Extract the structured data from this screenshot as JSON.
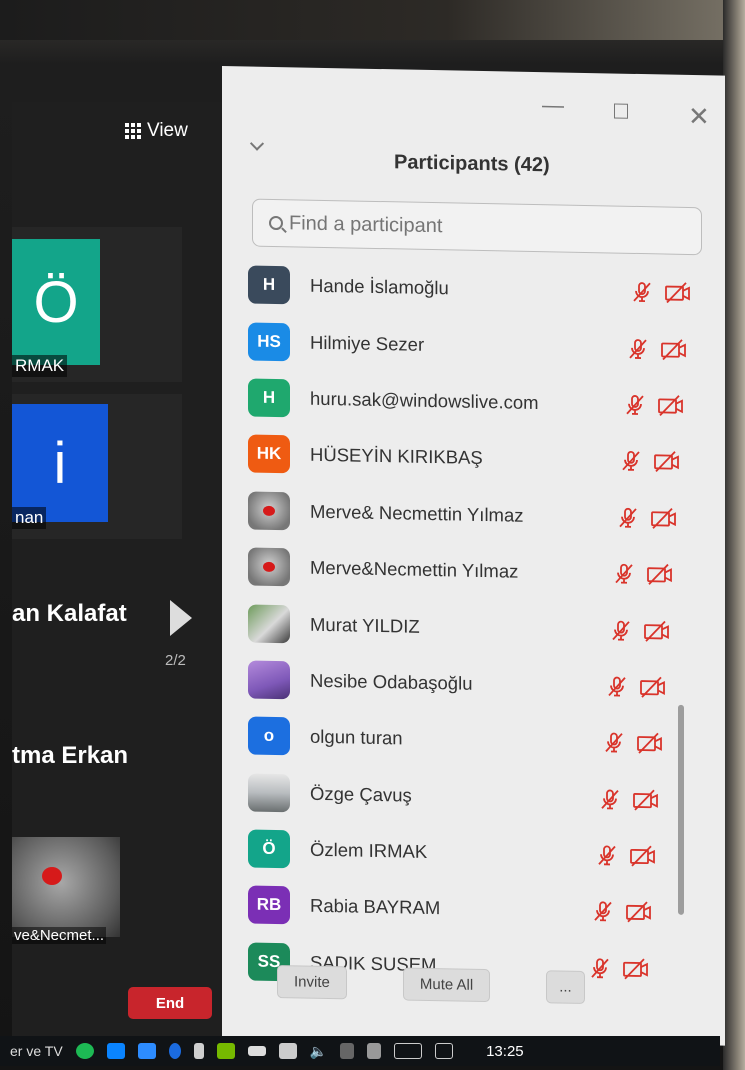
{
  "meeting": {
    "view_label": "View",
    "tiles": [
      {
        "initial": "Ö",
        "name": "RMAK",
        "color": "#13a58a"
      },
      {
        "initial": "i",
        "name": "nan",
        "color": "#1356d6"
      }
    ],
    "name_lines": [
      "an Kalafat",
      "tma Erkan"
    ],
    "page_indicator": "2/2",
    "thumb_name": "ve&Necmet...",
    "end_label": "End"
  },
  "panel": {
    "title": "Participants (42)",
    "search_placeholder": "Find a participant",
    "participants": [
      {
        "initials": "H",
        "name": "Hande İslamoğlu",
        "color": "#3a4a5c"
      },
      {
        "initials": "HS",
        "name": "Hilmiye Sezer",
        "color": "#1a8be6"
      },
      {
        "initials": "H",
        "name": "huru.sak@windowslive.com",
        "color": "#1fa86e"
      },
      {
        "initials": "HK",
        "name": "HÜSEYİN KIRIKBAŞ",
        "color": "#ef5b12"
      },
      {
        "initials": "",
        "name": "Merve& Necmettin Yılmaz",
        "color": "#8a8a8a",
        "photo": "rose"
      },
      {
        "initials": "",
        "name": "Merve&Necmettin Yılmaz",
        "color": "#8a8a8a",
        "photo": "rose"
      },
      {
        "initials": "",
        "name": "Murat YILDIZ",
        "color": "#6d9b5a",
        "photo": "person"
      },
      {
        "initials": "",
        "name": "Nesibe Odabaşoğlu",
        "color": "#8e6bc2",
        "photo": "purple"
      },
      {
        "initials": "o",
        "name": "olgun turan",
        "color": "#1c6fe0"
      },
      {
        "initials": "",
        "name": "Özge Çavuş",
        "color": "#9aa3a8",
        "photo": "landscape"
      },
      {
        "initials": "Ö",
        "name": "Özlem IRMAK",
        "color": "#13a58a"
      },
      {
        "initials": "RB",
        "name": "Rabia BAYRAM",
        "color": "#7b2fb5"
      },
      {
        "initials": "SS",
        "name": "SADIK SUSEM",
        "color": "#1c8a5a"
      }
    ],
    "invite_label": "Invite",
    "mute_all_label": "Mute All",
    "more_label": "..."
  },
  "taskbar": {
    "app_label": "er ve TV",
    "clock": "13:25"
  },
  "colors": {
    "muted_icon": "#d9342b",
    "end_button": "#c8252c"
  }
}
